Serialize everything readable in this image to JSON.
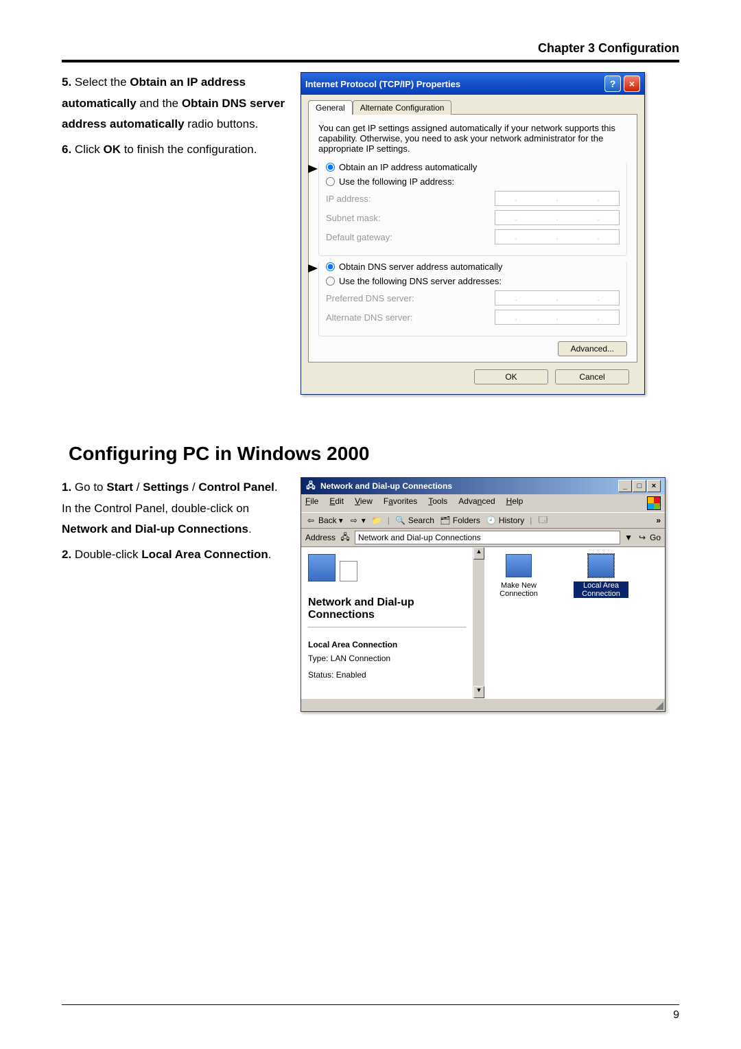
{
  "header": {
    "chapter": "Chapter 3 Configuration"
  },
  "sec1": {
    "steps": {
      "n5": "5.",
      "n6": "6.",
      "s5_pre": "Select the ",
      "s5_b1": "Obtain an IP address automatically",
      "s5_mid": " and the ",
      "s5_b2": "Obtain DNS server address automatically",
      "s5_post": " radio buttons.",
      "s6_pre": "Click ",
      "s6_b": "OK",
      "s6_post": " to finish the configuration."
    },
    "xp": {
      "title": "Internet Protocol (TCP/IP) Properties",
      "tab_general": "General",
      "tab_alt": "Alternate Configuration",
      "desc": "You can get IP settings assigned automatically if your network supports this capability. Otherwise, you need to ask your network administrator for the appropriate IP settings.",
      "r_auto_ip": "Obtain an IP address automatically",
      "r_use_ip": "Use the following IP address:",
      "f_ip": "IP address:",
      "f_subnet": "Subnet mask:",
      "f_gw": "Default gateway:",
      "r_auto_dns": "Obtain DNS server address automatically",
      "r_use_dns": "Use the following DNS server addresses:",
      "f_pdns": "Preferred DNS server:",
      "f_adns": "Alternate DNS server:",
      "btn_adv": "Advanced...",
      "btn_ok": "OK",
      "btn_cancel": "Cancel"
    }
  },
  "sec2": {
    "title": "Configuring PC in Windows 2000",
    "steps": {
      "n1": "1.",
      "n2": "2.",
      "s1_pre": "Go to ",
      "s1_b1": "Start",
      "s1_sl1": " / ",
      "s1_b2": "Settings",
      "s1_sl2": " / ",
      "s1_b3": "Control Panel",
      "s1_mid": ". In the Control Panel, double-click on ",
      "s1_b4": "Network and Dial-up Connections",
      "s1_post": ".",
      "s2_pre": "Double-click ",
      "s2_b": "Local Area Connection",
      "s2_post": "."
    },
    "w2k": {
      "title": "Network and Dial-up Connections",
      "menu": {
        "file": "File",
        "edit": "Edit",
        "view": "View",
        "fav": "Favorites",
        "tools": "Tools",
        "adv": "Advanced",
        "help": "Help"
      },
      "tb": {
        "back": "Back",
        "search": "Search",
        "folders": "Folders",
        "history": "History"
      },
      "addr_label": "Address",
      "addr_value": "Network and Dial-up Connections",
      "go": "Go",
      "left_title": "Network and Dial-up Connections",
      "left_selected": "Local Area Connection",
      "left_type": "Type: LAN Connection",
      "left_status": "Status: Enabled",
      "item_new": "Make New Connection",
      "item_lac": "Local Area Connection"
    }
  },
  "page_number": "9"
}
